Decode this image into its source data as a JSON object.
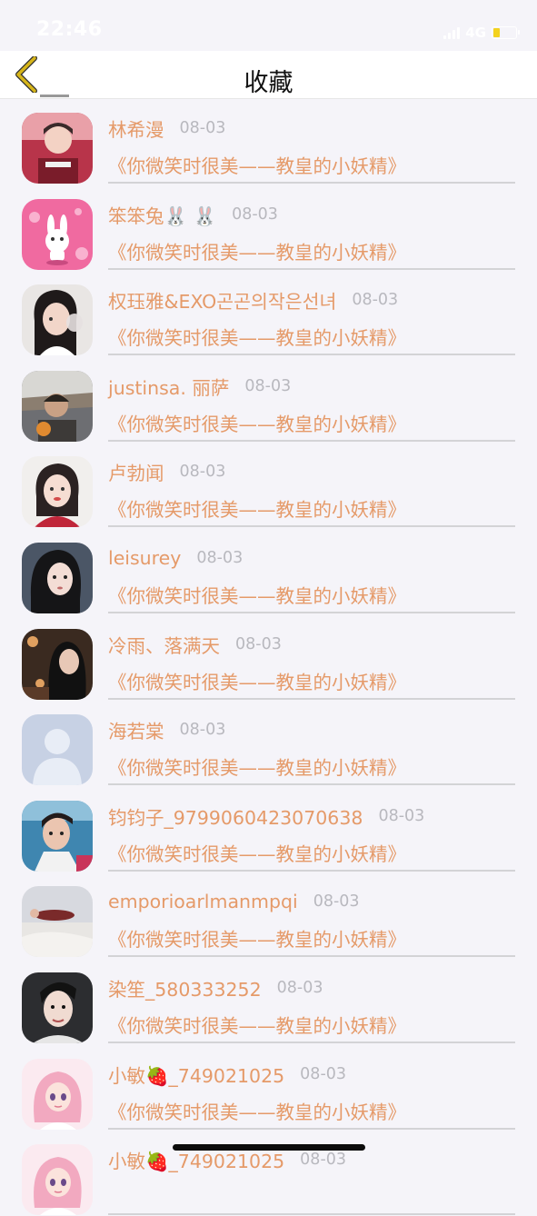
{
  "status": {
    "time": "22:46",
    "network": "4G"
  },
  "header": {
    "title": "收藏"
  },
  "icons": {
    "back": "chevron-left-icon"
  },
  "colors": {
    "accent": "#e59a69",
    "back_icon": "#d6b51a",
    "date": "#b8b8be",
    "background": "#f5f4f9"
  },
  "items": [
    {
      "name": "林希漫",
      "date": "08-03",
      "title": "《你微笑时很美——教皇的小妖精》",
      "avatar": "boy-red-jacket"
    },
    {
      "name": "笨笨兔🐰 🐰",
      "date": "08-03",
      "title": "《你微笑时很美——教皇的小妖精》",
      "avatar": "pink-bunny"
    },
    {
      "name": "权珏雅&EXO곤곤의작은선녀",
      "date": "08-03",
      "title": "《你微笑时很美——教皇的小妖精》",
      "avatar": "girl-drinking"
    },
    {
      "name": "justinsa. 丽萨",
      "date": "08-03",
      "title": "《你微笑时很美——教皇的小妖精》",
      "avatar": "man-sunlight"
    },
    {
      "name": "卢勃闻",
      "date": "08-03",
      "title": "《你微笑时很美——教皇的小妖精》",
      "avatar": "girl-red"
    },
    {
      "name": "leisurey",
      "date": "08-03",
      "title": "《你微笑时很美——教皇的小妖精》",
      "avatar": "girl-dark-hair"
    },
    {
      "name": "冷雨、落满天",
      "date": "08-03",
      "title": "《你微笑时很美——教皇的小妖精》",
      "avatar": "girl-night"
    },
    {
      "name": "海若棠",
      "date": "08-03",
      "title": "《你微笑时很美——教皇的小妖精》",
      "avatar": "default-user"
    },
    {
      "name": "钧钧子_979906042307063​8",
      "date": "08-03",
      "title": "《你微笑时很美——教皇的小妖精》",
      "avatar": "boy-collar"
    },
    {
      "name": "emporioarlmanmpqi",
      "date": "08-03",
      "title": "《你微笑时很美——教皇的小妖精》",
      "avatar": "lying-on-sand"
    },
    {
      "name": "染笙_580333252",
      "date": "08-03",
      "title": "《你微笑时很美——教皇的小妖精》",
      "avatar": "boy-portrait"
    },
    {
      "name": "小敏🍓_749021025",
      "date": "08-03",
      "title": "《你微笑时很美——教皇的小妖精》",
      "avatar": "anime-girl-pink"
    },
    {
      "name": "小敏🍓_749021025",
      "date": "08-03",
      "title": "",
      "avatar": "anime-girl-pink"
    }
  ]
}
